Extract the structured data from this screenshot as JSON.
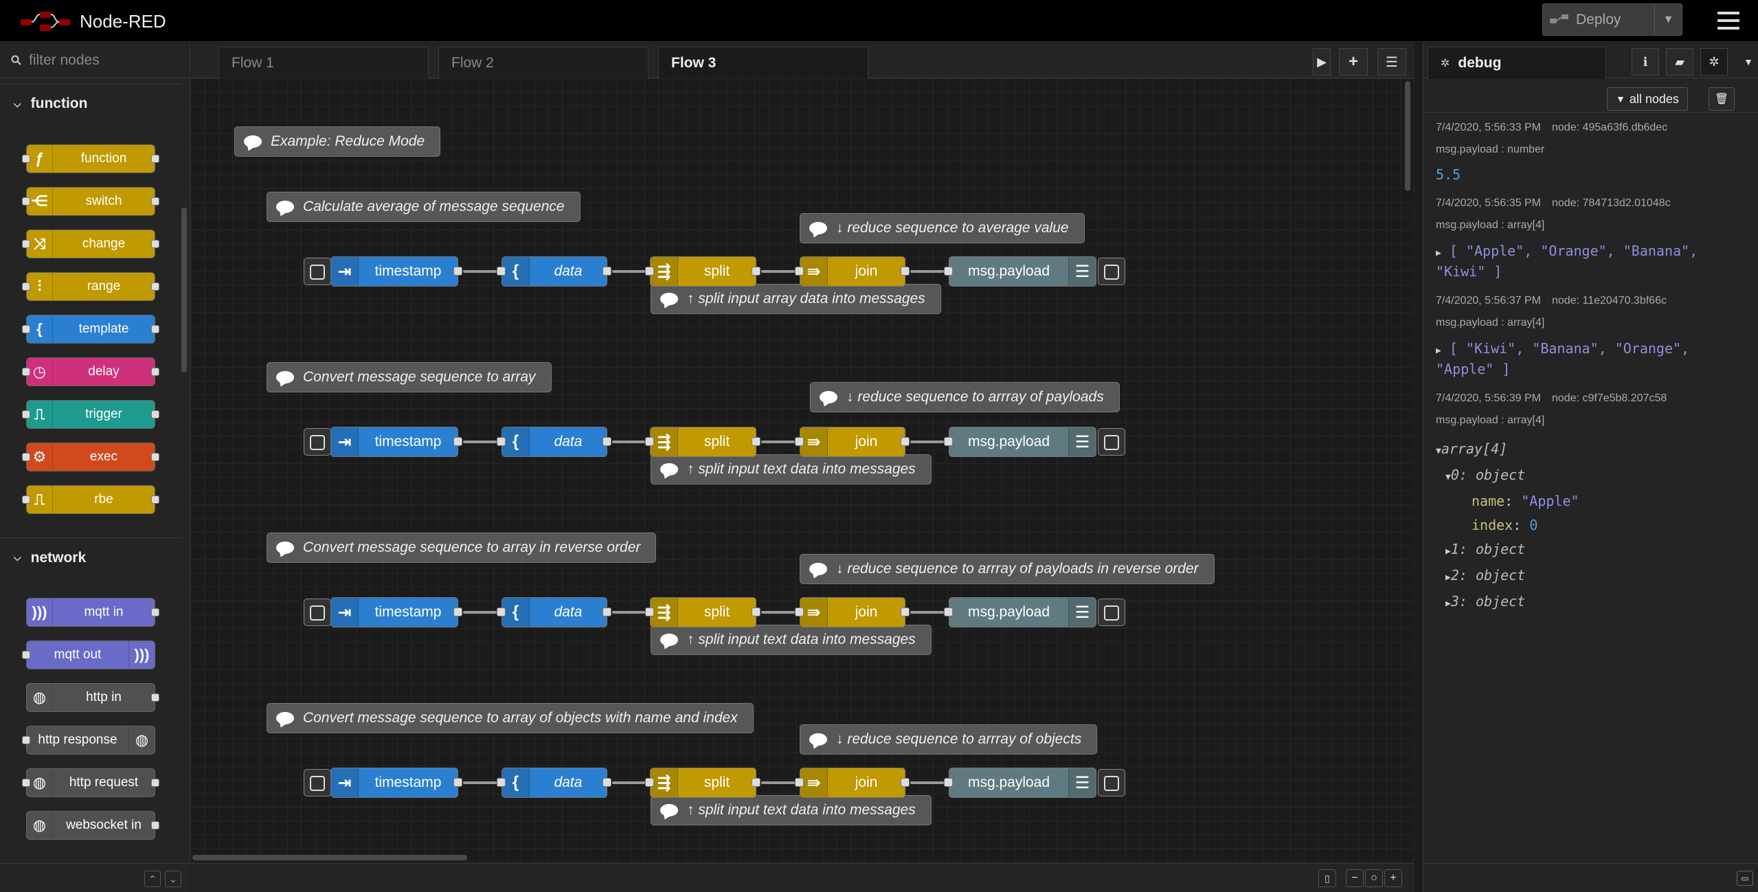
{
  "app": {
    "title": "Node-RED",
    "deploy_label": "Deploy"
  },
  "palette": {
    "filter_placeholder": "filter nodes",
    "categories": [
      {
        "label": "function",
        "nodes": [
          {
            "label": "function",
            "icon": "ƒ",
            "color": "#c09a00"
          },
          {
            "label": "switch",
            "icon": "⋲",
            "color": "#c09a00"
          },
          {
            "label": "change",
            "icon": "⤨",
            "color": "#c09a00"
          },
          {
            "label": "range",
            "icon": "⫶",
            "color": "#c09a00"
          },
          {
            "label": "template",
            "icon": "{",
            "color": "#2a7fd0"
          },
          {
            "label": "delay",
            "icon": "◷",
            "color": "#d0307a"
          },
          {
            "label": "trigger",
            "icon": "⎍",
            "color": "#1e9a8e"
          },
          {
            "label": "exec",
            "icon": "⚙",
            "color": "#d04a1e"
          },
          {
            "label": "rbe",
            "icon": "⎍",
            "color": "#c09a00"
          }
        ]
      },
      {
        "label": "network",
        "nodes": [
          {
            "label": "mqtt in",
            "icon": ")))",
            "color": "#6a6ac8"
          },
          {
            "label": "mqtt out",
            "icon": ")))",
            "color": "#6a6ac8"
          },
          {
            "label": "http in",
            "icon": "◍",
            "color": "#505050"
          },
          {
            "label": "http response",
            "icon": "◍",
            "color": "#505050"
          },
          {
            "label": "http request",
            "icon": "◍",
            "color": "#505050"
          },
          {
            "label": "websocket in",
            "icon": "◍",
            "color": "#505050"
          }
        ]
      }
    ]
  },
  "tabs": [
    {
      "label": "Flow 1"
    },
    {
      "label": "Flow 2"
    },
    {
      "label": "Flow 3"
    }
  ],
  "flow": {
    "title_comment": "Example: Reduce Mode",
    "rows": [
      {
        "comment": "Calculate average of message sequence",
        "reduce_comment": "↓ reduce sequence to average value",
        "split_comment": "↑ split input array data into messages"
      },
      {
        "comment": "Convert message sequence to array",
        "reduce_comment": "↓ reduce sequence to arrray of payloads",
        "split_comment": "↑ split input text data into messages"
      },
      {
        "comment": "Convert message sequence to array in reverse order",
        "reduce_comment": "↓ reduce sequence to arrray of payloads in reverse order",
        "split_comment": "↑ split input text data into messages"
      },
      {
        "comment": "Convert message sequence to array of objects with name and index",
        "reduce_comment": "↓ reduce sequence to arrray of objects",
        "split_comment": "↑ split input text data into messages"
      }
    ],
    "node_labels": {
      "inject": "timestamp",
      "template": "data",
      "split": "split",
      "join": "join",
      "debug": "msg.payload"
    },
    "colors": {
      "inject": "#2a7fd0",
      "template": "#2a7fd0",
      "split": "#c09a00",
      "join": "#c09a00",
      "debug": "#5f7a80"
    }
  },
  "sidebar": {
    "tab_label": "debug",
    "filter_button": "all nodes",
    "messages": [
      {
        "time": "7/4/2020, 5:56:33 PM",
        "node": "node: 495a63f6.db6dec",
        "type": "msg.payload : number",
        "value": "5.5"
      },
      {
        "time": "7/4/2020, 5:56:35 PM",
        "node": "node: 784713d2.01048c",
        "type": "msg.payload : array[4]",
        "line1": "[ \"Apple\", \"Orange\", \"Banana\",",
        "line2": "\"Kiwi\" ]"
      },
      {
        "time": "7/4/2020, 5:56:37 PM",
        "node": "node: 11e20470.3bf66c",
        "type": "msg.payload : array[4]",
        "line1": "[ \"Kiwi\", \"Banana\", \"Orange\",",
        "line2": "\"Apple\" ]"
      },
      {
        "time": "7/4/2020, 5:56:39 PM",
        "node": "node: c9f7e5b8.207c58",
        "type": "msg.payload : array[4]",
        "tree": {
          "root": "array[4]",
          "item0": "0: object",
          "name_key": "name",
          "name_val": "\"Apple\"",
          "index_key": "index",
          "index_val": "0",
          "item1": "1: object",
          "item2": "2: object",
          "item3": "3: object"
        }
      }
    ]
  }
}
